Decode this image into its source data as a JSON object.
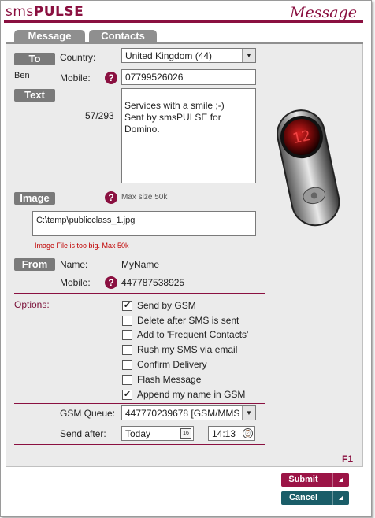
{
  "app": {
    "logo_prefix": "sms",
    "logo_suffix": "PULSE",
    "title": "Message",
    "form_code": "F1"
  },
  "tabs": [
    {
      "label": "Message"
    },
    {
      "label": "Contacts"
    }
  ],
  "to": {
    "section_label": "To",
    "contact_name": "Ben",
    "country_label": "Country:",
    "country_value": "United Kingdom (44)",
    "mobile_label": "Mobile:",
    "mobile_value": "07799526026"
  },
  "text": {
    "section_label": "Text",
    "counter": "57/293",
    "message_lines": [
      "Services with a smile ;-)",
      "Sent by smsPULSE for",
      "Domino."
    ]
  },
  "image": {
    "section_label": "Image",
    "max_size": "Max size 50k",
    "path": "C:\\temp\\publicclass_1.jpg",
    "error": "Image File is too big. Max 50k"
  },
  "from": {
    "section_label": "From",
    "name_label": "Name:",
    "name_value": "MyName",
    "mobile_label": "Mobile:",
    "mobile_value": "447787538925"
  },
  "options": {
    "label": "Options:",
    "items": [
      {
        "label": "Send by GSM",
        "checked": true
      },
      {
        "label": "Delete after SMS is sent",
        "checked": false
      },
      {
        "label": "Add to 'Frequent Contacts'",
        "checked": false
      },
      {
        "label": "Rush my SMS via email",
        "checked": false
      },
      {
        "label": "Confirm Delivery",
        "checked": false
      },
      {
        "label": "Flash Message",
        "checked": false
      },
      {
        "label": "Append my name in GSM",
        "checked": true
      }
    ]
  },
  "gsm_queue": {
    "label": "GSM Queue:",
    "value": "447770239678 [GSM/MMS"
  },
  "send_after": {
    "label": "Send after:",
    "date_value": "Today",
    "date_icon_text": "16",
    "time_value": "14:13"
  },
  "buttons": {
    "submit": "Submit",
    "cancel": "Cancel"
  },
  "colors": {
    "accent": "#8a1040",
    "section_label_bg": "#7a7a7a",
    "submit_bg": "#9b1446",
    "cancel_bg": "#1a5d68"
  }
}
